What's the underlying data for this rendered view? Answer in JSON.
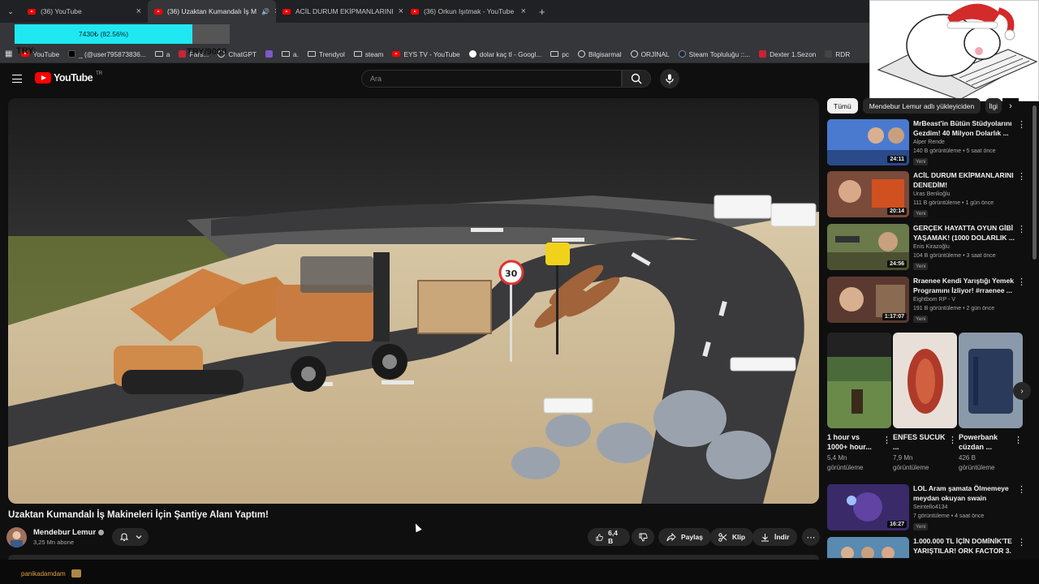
{
  "browser": {
    "tabs": [
      {
        "label": "(36) YouTube"
      },
      {
        "label": "(36) Uzaktan Kumandalı İş M"
      },
      {
        "label": "ACİL DURUM EKİPMANLARINI"
      },
      {
        "label": "(36) Orkun Işıtmak - YouTube"
      }
    ],
    "download": {
      "progress_label": "7430₺ (82.56%)",
      "progress": 0.8256
    },
    "overlay_try": "TRY:",
    "overlay_price": "TRY/9000",
    "bookmarks": [
      "YouTube",
      "_ (@user795873836...",
      "a",
      "Pars...",
      "ChatGPT",
      "",
      "a.",
      "Trendyol",
      "steam",
      "EYS TV - YouTube",
      "dolar kaç tl - Googl...",
      "pc",
      "Bilgisarmal",
      "ORJİNAL",
      "Steam Topluluğu ::...",
      "Dexter 1.Sezon",
      "RDR"
    ]
  },
  "masthead": {
    "logo_text": "YouTube",
    "logo_region": "TR",
    "search_placeholder": "Ara"
  },
  "video": {
    "title": "Uzaktan Kumandalı İş Makineleri İçin Şantiye Alanı Yaptım!",
    "channel": "Mendebur Lemur",
    "subscribers": "3,25 Mn abone",
    "likes": "6,4 B",
    "share_label": "Paylaş",
    "clip_label": "Klip",
    "download_label": "İndir"
  },
  "sidebar": {
    "chips": [
      "Tümü",
      "Mendebur Lemur adlı yükleyiciden",
      "İlgi"
    ],
    "recommendations_top": [
      {
        "title": "MrBeast'in Bütün Stüdyolarını Gezdim! 40 Milyon Dolarlık ...",
        "channel": "Alper Rende",
        "meta": "140 B görüntüleme • 5 saat önce",
        "badge": "Yeni",
        "duration": "24:11",
        "thumb_color": "#3a6ec0"
      },
      {
        "title": "ACİL DURUM EKİPMANLARINI DENEDİM!",
        "channel": "Uras Benlioğlu",
        "meta": "111 B görüntüleme • 1 gün önce",
        "badge": "Yeni",
        "duration": "20:14",
        "thumb_color": "#b5502a"
      },
      {
        "title": "GERÇEK HAYATTA OYUN GİBİ YAŞAMAK! (1000 DOLARLIK ...",
        "channel": "Enis Kirazoğlu",
        "meta": "104 B görüntüleme • 3 saat önce",
        "badge": "Yeni",
        "duration": "24:56",
        "thumb_color": "#5f6a3a"
      },
      {
        "title": "Rraenee Kendi Yarıştığı Yemek Programını İzliyor! #rraenee ...",
        "channel": "Eightbom RP - V",
        "meta": "191 B görüntüleme • 2 gün önce",
        "badge": "Yeni",
        "duration": "1:17:07",
        "thumb_color": "#7a5540"
      }
    ],
    "shorts": [
      {
        "title": "1 hour vs 1000+ hour...",
        "views": "5,4 Mn görüntüleme",
        "thumb_color": "#4a6a3a"
      },
      {
        "title": "ENFES SUCUK ...",
        "views": "7,9 Mn görüntüleme",
        "thumb_color": "#a04030"
      },
      {
        "title": "Powerbank cüzdan ...",
        "views": "426 B görüntüleme",
        "thumb_color": "#3a4f6a"
      }
    ],
    "recommendations_bottom": [
      {
        "title": "LOL Aram şamata Ölmemeye meydan okuyan swain",
        "channel": "Seintello4134",
        "meta": "7 görüntüleme • 4 saat önce",
        "badge": "Yeni",
        "duration": "16:27",
        "thumb_color": "#4a3a7a"
      },
      {
        "title": "1.000.000 TL İÇİN DOMİNİK'TE YARIŞTILAR! ORK FACTOR 3. ...",
        "channel": "",
        "meta": "",
        "badge": "",
        "duration": "",
        "thumb_color": "#5a8ab0"
      }
    ]
  },
  "taskbar": {
    "text": "panikadamdam"
  }
}
